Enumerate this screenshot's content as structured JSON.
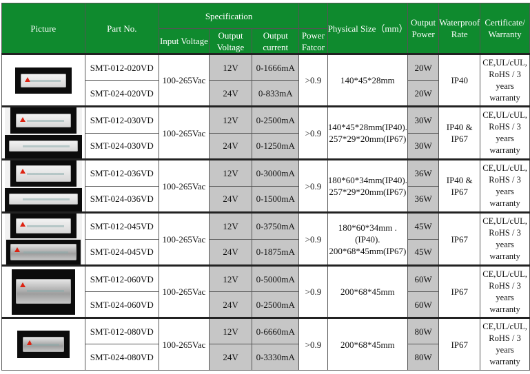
{
  "header": {
    "picture": "Picture",
    "part_no": "Part No.",
    "specification": "Specification",
    "input_voltage": "Input Voltage",
    "output_voltage": "Output Voltage",
    "output_current": "Output current",
    "power_factor": "Power Fatcor",
    "physical_size": "Physical Size（mm）",
    "output_power": "Output Power",
    "waterproof_rate": "Waterproof Rate",
    "certificate": "Certificate/ Warranty"
  },
  "rows": [
    {
      "part_a": "SMT-012-020VD",
      "part_b": "SMT-024-020VD",
      "input": "100-265Vac",
      "volt_a": "12V",
      "volt_b": "24V",
      "cur_a": "0-1666mA",
      "cur_b": "0-833mA",
      "pf": ">0.9",
      "size": "140*45*28mm",
      "pow_a": "20W",
      "pow_b": "20W",
      "ip": "IP40",
      "cert": "CE,UL/cUL, RoHS / 3 years warranty"
    },
    {
      "part_a": "SMT-012-030VD",
      "part_b": "SMT-024-030VD",
      "input": "100-265Vac",
      "volt_a": "12V",
      "volt_b": "24V",
      "cur_a": "0-2500mA",
      "cur_b": "0-1250mA",
      "pf": ">0.9",
      "size": "140*45*28mm(IP40). 257*29*20mm(IP67)",
      "pow_a": "30W",
      "pow_b": "30W",
      "ip": "IP40 & IP67",
      "cert": "CE,UL/cUL, RoHS / 3 years warranty"
    },
    {
      "part_a": "SMT-012-036VD",
      "part_b": "SMT-024-036VD",
      "input": "100-265Vac",
      "volt_a": "12V",
      "volt_b": "24V",
      "cur_a": "0-3000mA",
      "cur_b": "0-1500mA",
      "pf": ">0.9",
      "size": "180*60*34mm(IP40). 257*29*20mm(IP67)",
      "pow_a": "36W",
      "pow_b": "36W",
      "ip": "IP40 & IP67",
      "cert": "CE,UL/cUL, RoHS / 3 years warranty"
    },
    {
      "part_a": "SMT-012-045VD",
      "part_b": "SMT-024-045VD",
      "input": "100-265Vac",
      "volt_a": "12V",
      "volt_b": "24V",
      "cur_a": "0-3750mA",
      "cur_b": "0-1875mA",
      "pf": ">0.9",
      "size": "180*60*34mm . (IP40). 200*68*45mm(IP67)",
      "pow_a": "45W",
      "pow_b": "45W",
      "ip": "IP67",
      "cert": "CE,UL/cUL, RoHS / 3 years warranty"
    },
    {
      "part_a": "SMT-012-060VD",
      "part_b": "SMT-024-060VD",
      "input": "100-265Vac",
      "volt_a": "12V",
      "volt_b": "24V",
      "cur_a": "0-5000mA",
      "cur_b": "0-2500mA",
      "pf": ">0.9",
      "size": "200*68*45mm",
      "pow_a": "60W",
      "pow_b": "60W",
      "ip": "IP67",
      "cert": "CE,UL/cUL, RoHS / 3 years warranty"
    },
    {
      "part_a": "SMT-012-080VD",
      "part_b": "SMT-024-080VD",
      "input": "100-265Vac",
      "volt_a": "12V",
      "volt_b": "24V",
      "cur_a": "0-6660mA",
      "cur_b": "0-3330mA",
      "pf": ">0.9",
      "size": "200*68*45mm",
      "pow_a": "80W",
      "pow_b": "80W",
      "ip": "IP67",
      "cert": "CE,UL/cUL, RoHS / 3 years warranty"
    }
  ],
  "colors": {
    "header_bg": "#0f8a2e",
    "header_text": "#ffffff",
    "gray_cell": "#c6c6c6"
  },
  "icons": [
    "led-driver-photo"
  ]
}
